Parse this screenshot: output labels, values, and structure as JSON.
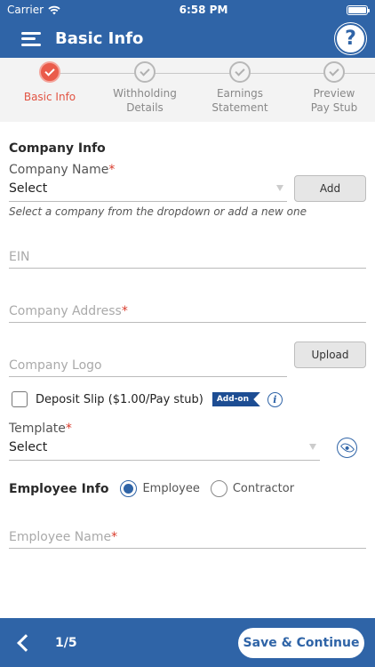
{
  "status_bar": {
    "carrier": "Carrier",
    "time": "6:58 PM"
  },
  "header": {
    "title": "Basic Info",
    "help_symbol": "?"
  },
  "stepper": {
    "steps": [
      {
        "label_line1": "Basic Info",
        "label_line2": "",
        "state": "active"
      },
      {
        "label_line1": "Withholding",
        "label_line2": "Details",
        "state": "pending"
      },
      {
        "label_line1": "Earnings",
        "label_line2": "Statement",
        "state": "pending"
      },
      {
        "label_line1": "Preview",
        "label_line2": "Pay Stub",
        "state": "pending"
      }
    ]
  },
  "company_info": {
    "title": "Company Info",
    "company_name": {
      "label": "Company Name",
      "required_mark": "*",
      "value": "Select",
      "add_button": "Add",
      "helper": "Select a company from the dropdown or add a new one"
    },
    "ein": {
      "placeholder": "EIN"
    },
    "company_address": {
      "placeholder": "Company Address",
      "required_mark": "*"
    },
    "company_logo": {
      "placeholder": "Company Logo",
      "upload_button": "Upload"
    },
    "deposit_slip": {
      "label": "Deposit Slip ($1.00/Pay stub)",
      "badge": "Add-on",
      "info_symbol": "i",
      "checked": false
    },
    "template": {
      "label": "Template",
      "required_mark": "*",
      "value": "Select"
    }
  },
  "employee_info": {
    "title": "Employee Info",
    "options": [
      {
        "label": "Employee",
        "selected": true
      },
      {
        "label": "Contractor",
        "selected": false
      }
    ],
    "employee_name": {
      "placeholder": "Employee Name",
      "required_mark": "*"
    }
  },
  "footer": {
    "page_indicator": "1/5",
    "save_button": "Save & Continue"
  },
  "colors": {
    "primary": "#2f64a7",
    "accent": "#ea5b4b",
    "required": "#d93a2b"
  }
}
